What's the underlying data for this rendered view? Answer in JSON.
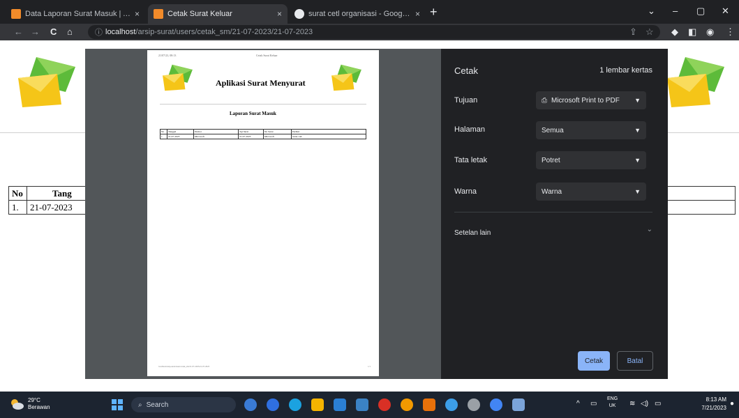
{
  "browser": {
    "tabs": [
      {
        "title": "Data Laporan Surat Masuk | Apl",
        "close": "×",
        "color": "#f28b2a"
      },
      {
        "title": "Cetak Surat Keluar",
        "close": "×",
        "color": "#f28b2a"
      },
      {
        "title": "surat cetl organisasi - Google Pr",
        "close": "×",
        "color": "#e8eaed"
      }
    ],
    "new_tab": "+",
    "window_controls": {
      "chevron": "⌄",
      "minimize": "–",
      "maximize": "▢",
      "close": "✕"
    },
    "nav": {
      "back": "←",
      "forward": "→",
      "reload": "C",
      "home": "⌂"
    },
    "address": {
      "host": "localhost",
      "path": "/arsip-surat/users/cetak_sm/21-07-2023/21-07-2023"
    },
    "toolbar_icons": {
      "share": "⇪",
      "star": "☆",
      "extensions": "◆",
      "sidepanel": "◧",
      "profile": "◉",
      "menu": "⋮"
    }
  },
  "background_page": {
    "table": {
      "headers": [
        "No",
        "Tang"
      ],
      "rows": [
        [
          "1.",
          "21-07-2023"
        ]
      ]
    }
  },
  "print_preview": {
    "sheet_header_left": "21/07/23, 08:13",
    "sheet_header_center": "Cetak Surat Keluar",
    "title": "Aplikasi Surat Menyurat",
    "subtitle": "Laporan Surat Masuk",
    "table_headers": [
      "No",
      "Tanggal",
      "Nomor",
      "Tgl Surat",
      "No Surat",
      "Perihal"
    ],
    "table_rows": [
      [
        "1",
        "21-07-2023",
        "Microsoft",
        "21-07-2023",
        "Microsoft",
        "Surat cuti"
      ]
    ],
    "footer_left": "localhost/arsip-surat/users/cetak_sm/21-07-2023/21-07-2023",
    "footer_right": "1/1"
  },
  "print_panel": {
    "title": "Cetak",
    "sheet_count": "1 lembar kertas",
    "destination_label": "Tujuan",
    "destination_value": "Microsoft Print to PDF",
    "pages_label": "Halaman",
    "pages_value": "Semua",
    "layout_label": "Tata letak",
    "layout_value": "Potret",
    "color_label": "Warna",
    "color_value": "Warna",
    "more_settings_label": "Setelan lain",
    "print_button": "Cetak",
    "cancel_button": "Batal"
  },
  "taskbar": {
    "temperature": "29°C",
    "weather": "Berawan",
    "search_placeholder": "Search",
    "tray_lang_1": "ENG",
    "tray_lang_2": "UK",
    "time": "8:13 AM",
    "date": "7/21/2023"
  },
  "colors": {
    "accent_blue": "#8ab4f8",
    "panel_bg": "#202124",
    "preview_bg": "#525659",
    "envelope_yellow": "#f5c518",
    "envelope_green": "#5dbb3a"
  }
}
